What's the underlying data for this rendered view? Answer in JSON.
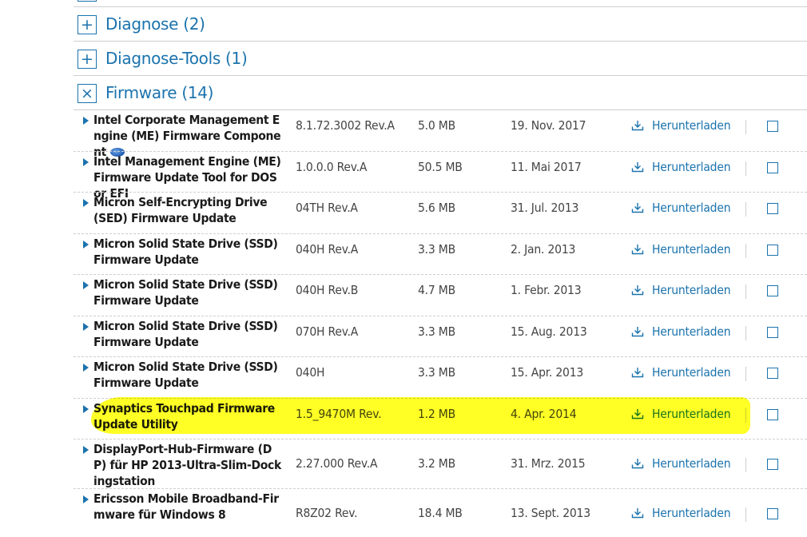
{
  "categories": [
    {
      "toggle": "+",
      "label": "Diagnose (2)"
    },
    {
      "toggle": "+",
      "label": "Diagnose-Tools (1)"
    },
    {
      "toggle": "×",
      "label": "Firmware (14)"
    }
  ],
  "rows": [
    {
      "name": "Intel Corporate Management Engine (ME) Firmware Component",
      "version": "8.1.72.3002 Rev.A",
      "size": "5.0 MB",
      "date": "19. Nov. 2017",
      "download": "Herunterladen",
      "has_icon": true
    },
    {
      "name": "Intel Management Engine (ME) Firmware Update Tool for DOS or EFI",
      "version": "1.0.0.0 Rev.A",
      "size": "50.5 MB",
      "date": "11. Mai 2017",
      "download": "Herunterladen"
    },
    {
      "name": "Micron Self-Encrypting Drive (SED) Firmware Update",
      "version": "04TH Rev.A",
      "size": "5.6 MB",
      "date": "31. Jul. 2013",
      "download": "Herunterladen"
    },
    {
      "name": "Micron Solid State Drive (SSD) Firmware Update",
      "version": "040H Rev.A",
      "size": "3.3 MB",
      "date": "2. Jan. 2013",
      "download": "Herunterladen"
    },
    {
      "name": "Micron Solid State Drive (SSD) Firmware Update",
      "version": "040H Rev.B",
      "size": "4.7 MB",
      "date": "1. Febr. 2013",
      "download": "Herunterladen"
    },
    {
      "name": "Micron Solid State Drive (SSD) Firmware Update",
      "version": "070H Rev.A",
      "size": "3.3 MB",
      "date": "15. Aug. 2013",
      "download": "Herunterladen"
    },
    {
      "name": "Micron Solid State Drive (SSD) Firmware Update",
      "version": "040H",
      "size": "3.3 MB",
      "date": "15. Apr. 2013",
      "download": "Herunterladen"
    },
    {
      "name": "Synaptics Touchpad Firmware Update Utility",
      "version": "1.5_9470M Rev.",
      "size": "1.2 MB",
      "date": "4. Apr. 2014",
      "download": "Herunterladen",
      "highlighted": true
    },
    {
      "name": "DisplayPort-Hub-Firmware (DP) für HP 2013-Ultra-Slim-Dockingstation",
      "version": "2.27.000 Rev.A",
      "size": "3.2 MB",
      "date": "31. Mrz. 2015",
      "download": "Herunterladen"
    },
    {
      "name": "Ericsson Mobile Broadband-Firmware für Windows 8",
      "version": "R8Z02 Rev.",
      "size": "18.4 MB",
      "date": "13. Sept. 2013",
      "download": "Herunterladen"
    }
  ],
  "colors": {
    "accent": "#1b73ad",
    "highlight": "#ffff00"
  }
}
